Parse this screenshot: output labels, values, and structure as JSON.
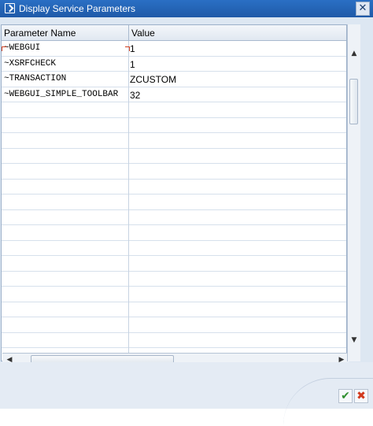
{
  "window": {
    "title": "Display Service Parameters",
    "close_glyph": "✕"
  },
  "table": {
    "headers": [
      "Parameter Name",
      "Value"
    ],
    "rows": [
      {
        "name": "~WEBGUI",
        "value": "1"
      },
      {
        "name": "~XSRFCHECK",
        "value": "1"
      },
      {
        "name": "~TRANSACTION",
        "value": "ZCUSTOM"
      },
      {
        "name": "~WEBGUI_SIMPLE_TOOLBAR",
        "value": "32"
      },
      {
        "name": "",
        "value": ""
      },
      {
        "name": "",
        "value": ""
      },
      {
        "name": "",
        "value": ""
      },
      {
        "name": "",
        "value": ""
      },
      {
        "name": "",
        "value": ""
      },
      {
        "name": "",
        "value": ""
      },
      {
        "name": "",
        "value": ""
      },
      {
        "name": "",
        "value": ""
      },
      {
        "name": "",
        "value": ""
      },
      {
        "name": "",
        "value": ""
      },
      {
        "name": "",
        "value": ""
      },
      {
        "name": "",
        "value": ""
      },
      {
        "name": "",
        "value": ""
      },
      {
        "name": "",
        "value": ""
      },
      {
        "name": "",
        "value": ""
      },
      {
        "name": "",
        "value": ""
      },
      {
        "name": "",
        "value": ""
      }
    ]
  },
  "icons": {
    "title": "display-window-icon",
    "close": "close-icon",
    "confirm": "checkmark-icon",
    "cancel": "cancel-icon"
  },
  "colors": {
    "titlebar": "#1f5aa8",
    "confirm": "#2f8f2f",
    "cancel": "#d23a1e",
    "focus": "#d04020"
  }
}
